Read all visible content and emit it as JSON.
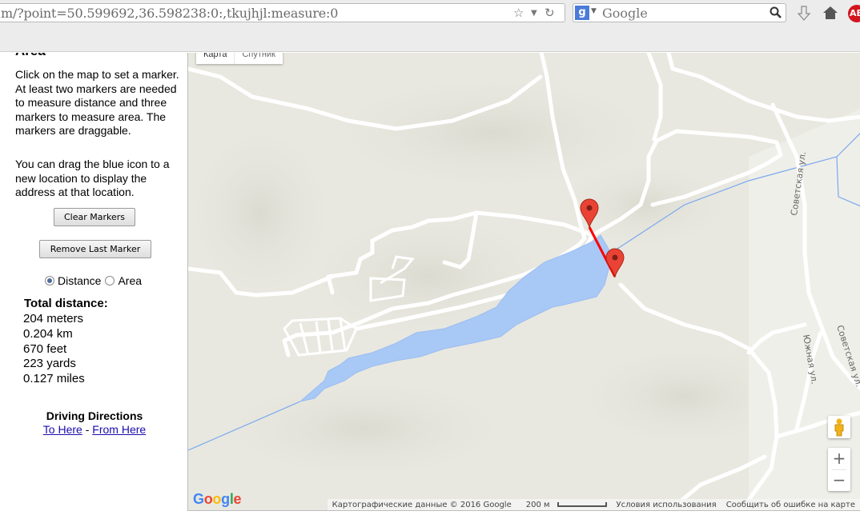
{
  "browser": {
    "url": "m/?point=50.599692,36.598238:0:,tkujhjl:measure:0",
    "search_engine_letter": "g",
    "search_placeholder": "Google",
    "adblock_label": "AB"
  },
  "panel": {
    "title": "Area",
    "instructions": "Click on the map to set a marker. At least two markers are needed to measure distance and three markers to measure area. The markers are draggable.",
    "drag_hint": "You can drag the blue icon to a new location to display the address at that location.",
    "clear_button": "Clear Markers",
    "remove_button": "Remove Last Marker",
    "mode_distance": "Distance",
    "mode_area": "Area",
    "selected_mode": "Distance",
    "total_title": "Total distance:",
    "results": [
      "204 meters",
      "0.204 km",
      "670 feet",
      "223 yards",
      "0.127 miles"
    ],
    "driving_title": "Driving Directions",
    "to_here": "To Here",
    "link_separator": " - ",
    "from_here": "From Here"
  },
  "map": {
    "type_map": "Карта",
    "type_satellite": "Спутник",
    "streets": [
      "Советская ул.",
      "Советская ул.",
      "Южная ул."
    ],
    "zoom_in": "+",
    "zoom_out": "−",
    "logo": "Google",
    "attribution": "Картографические данные © 2016 Google",
    "scale_label": "200 м",
    "terms": "Условия использования",
    "report": "Сообщить об ошибке на карте",
    "colors": {
      "water": "#a8c8f6",
      "road": "#ffffff",
      "measure_line": "#ff0000",
      "marker": "#ea4335",
      "land": "#e8e8e0"
    }
  }
}
